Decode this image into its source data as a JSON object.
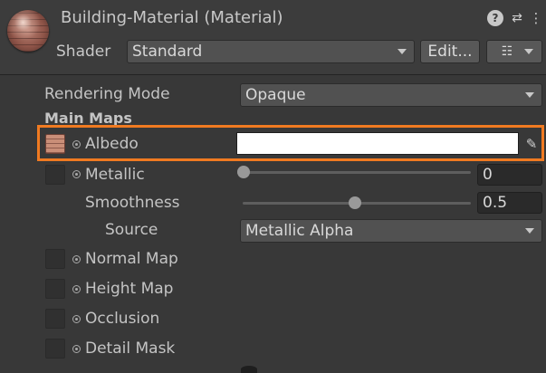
{
  "header": {
    "title": "Building-Material (Material)",
    "shader_label": "Shader",
    "shader_value": "Standard",
    "edit_label": "Edit...",
    "list_icon": "☷",
    "help_icon": "?",
    "presets_icon": "⇄",
    "more_icon": "⋮"
  },
  "properties": {
    "rendering_mode_label": "Rendering Mode",
    "rendering_mode_value": "Opaque",
    "main_maps_label": "Main Maps",
    "albedo_label": "Albedo",
    "albedo_color": "#ffffff",
    "metallic_label": "Metallic",
    "metallic_value": "0",
    "smoothness_label": "Smoothness",
    "smoothness_value": "0.5",
    "source_label": "Source",
    "source_value": "Metallic Alpha",
    "normal_map_label": "Normal Map",
    "height_map_label": "Height Map",
    "occlusion_label": "Occlusion",
    "detail_mask_label": "Detail Mask"
  },
  "colors": {
    "highlight": "#f07a21",
    "background": "#383838"
  }
}
